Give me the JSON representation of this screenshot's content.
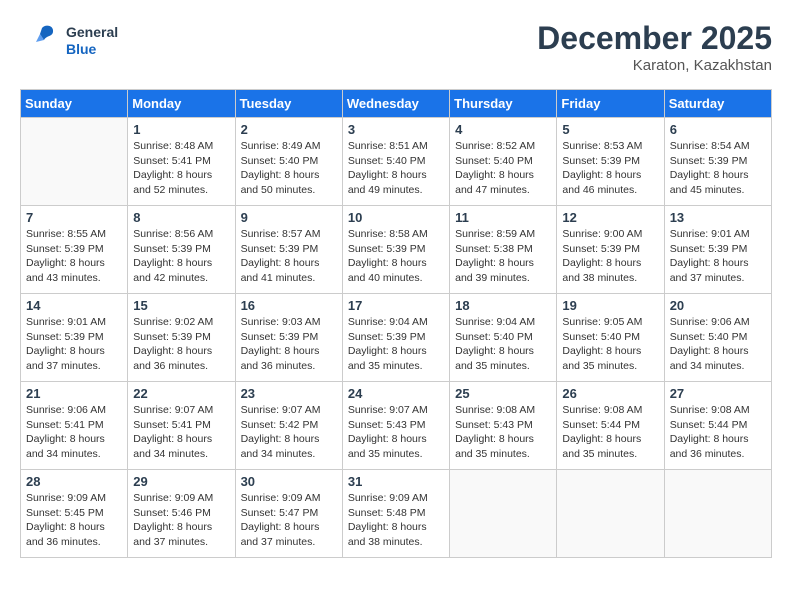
{
  "header": {
    "logo_general": "General",
    "logo_blue": "Blue",
    "month": "December 2025",
    "location": "Karaton, Kazakhstan"
  },
  "weekdays": [
    "Sunday",
    "Monday",
    "Tuesday",
    "Wednesday",
    "Thursday",
    "Friday",
    "Saturday"
  ],
  "weeks": [
    [
      {
        "day": "",
        "sunrise": "",
        "sunset": "",
        "daylight": ""
      },
      {
        "day": "1",
        "sunrise": "Sunrise: 8:48 AM",
        "sunset": "Sunset: 5:41 PM",
        "daylight": "Daylight: 8 hours and 52 minutes."
      },
      {
        "day": "2",
        "sunrise": "Sunrise: 8:49 AM",
        "sunset": "Sunset: 5:40 PM",
        "daylight": "Daylight: 8 hours and 50 minutes."
      },
      {
        "day": "3",
        "sunrise": "Sunrise: 8:51 AM",
        "sunset": "Sunset: 5:40 PM",
        "daylight": "Daylight: 8 hours and 49 minutes."
      },
      {
        "day": "4",
        "sunrise": "Sunrise: 8:52 AM",
        "sunset": "Sunset: 5:40 PM",
        "daylight": "Daylight: 8 hours and 47 minutes."
      },
      {
        "day": "5",
        "sunrise": "Sunrise: 8:53 AM",
        "sunset": "Sunset: 5:39 PM",
        "daylight": "Daylight: 8 hours and 46 minutes."
      },
      {
        "day": "6",
        "sunrise": "Sunrise: 8:54 AM",
        "sunset": "Sunset: 5:39 PM",
        "daylight": "Daylight: 8 hours and 45 minutes."
      }
    ],
    [
      {
        "day": "7",
        "sunrise": "Sunrise: 8:55 AM",
        "sunset": "Sunset: 5:39 PM",
        "daylight": "Daylight: 8 hours and 43 minutes."
      },
      {
        "day": "8",
        "sunrise": "Sunrise: 8:56 AM",
        "sunset": "Sunset: 5:39 PM",
        "daylight": "Daylight: 8 hours and 42 minutes."
      },
      {
        "day": "9",
        "sunrise": "Sunrise: 8:57 AM",
        "sunset": "Sunset: 5:39 PM",
        "daylight": "Daylight: 8 hours and 41 minutes."
      },
      {
        "day": "10",
        "sunrise": "Sunrise: 8:58 AM",
        "sunset": "Sunset: 5:39 PM",
        "daylight": "Daylight: 8 hours and 40 minutes."
      },
      {
        "day": "11",
        "sunrise": "Sunrise: 8:59 AM",
        "sunset": "Sunset: 5:38 PM",
        "daylight": "Daylight: 8 hours and 39 minutes."
      },
      {
        "day": "12",
        "sunrise": "Sunrise: 9:00 AM",
        "sunset": "Sunset: 5:39 PM",
        "daylight": "Daylight: 8 hours and 38 minutes."
      },
      {
        "day": "13",
        "sunrise": "Sunrise: 9:01 AM",
        "sunset": "Sunset: 5:39 PM",
        "daylight": "Daylight: 8 hours and 37 minutes."
      }
    ],
    [
      {
        "day": "14",
        "sunrise": "Sunrise: 9:01 AM",
        "sunset": "Sunset: 5:39 PM",
        "daylight": "Daylight: 8 hours and 37 minutes."
      },
      {
        "day": "15",
        "sunrise": "Sunrise: 9:02 AM",
        "sunset": "Sunset: 5:39 PM",
        "daylight": "Daylight: 8 hours and 36 minutes."
      },
      {
        "day": "16",
        "sunrise": "Sunrise: 9:03 AM",
        "sunset": "Sunset: 5:39 PM",
        "daylight": "Daylight: 8 hours and 36 minutes."
      },
      {
        "day": "17",
        "sunrise": "Sunrise: 9:04 AM",
        "sunset": "Sunset: 5:39 PM",
        "daylight": "Daylight: 8 hours and 35 minutes."
      },
      {
        "day": "18",
        "sunrise": "Sunrise: 9:04 AM",
        "sunset": "Sunset: 5:40 PM",
        "daylight": "Daylight: 8 hours and 35 minutes."
      },
      {
        "day": "19",
        "sunrise": "Sunrise: 9:05 AM",
        "sunset": "Sunset: 5:40 PM",
        "daylight": "Daylight: 8 hours and 35 minutes."
      },
      {
        "day": "20",
        "sunrise": "Sunrise: 9:06 AM",
        "sunset": "Sunset: 5:40 PM",
        "daylight": "Daylight: 8 hours and 34 minutes."
      }
    ],
    [
      {
        "day": "21",
        "sunrise": "Sunrise: 9:06 AM",
        "sunset": "Sunset: 5:41 PM",
        "daylight": "Daylight: 8 hours and 34 minutes."
      },
      {
        "day": "22",
        "sunrise": "Sunrise: 9:07 AM",
        "sunset": "Sunset: 5:41 PM",
        "daylight": "Daylight: 8 hours and 34 minutes."
      },
      {
        "day": "23",
        "sunrise": "Sunrise: 9:07 AM",
        "sunset": "Sunset: 5:42 PM",
        "daylight": "Daylight: 8 hours and 34 minutes."
      },
      {
        "day": "24",
        "sunrise": "Sunrise: 9:07 AM",
        "sunset": "Sunset: 5:43 PM",
        "daylight": "Daylight: 8 hours and 35 minutes."
      },
      {
        "day": "25",
        "sunrise": "Sunrise: 9:08 AM",
        "sunset": "Sunset: 5:43 PM",
        "daylight": "Daylight: 8 hours and 35 minutes."
      },
      {
        "day": "26",
        "sunrise": "Sunrise: 9:08 AM",
        "sunset": "Sunset: 5:44 PM",
        "daylight": "Daylight: 8 hours and 35 minutes."
      },
      {
        "day": "27",
        "sunrise": "Sunrise: 9:08 AM",
        "sunset": "Sunset: 5:44 PM",
        "daylight": "Daylight: 8 hours and 36 minutes."
      }
    ],
    [
      {
        "day": "28",
        "sunrise": "Sunrise: 9:09 AM",
        "sunset": "Sunset: 5:45 PM",
        "daylight": "Daylight: 8 hours and 36 minutes."
      },
      {
        "day": "29",
        "sunrise": "Sunrise: 9:09 AM",
        "sunset": "Sunset: 5:46 PM",
        "daylight": "Daylight: 8 hours and 37 minutes."
      },
      {
        "day": "30",
        "sunrise": "Sunrise: 9:09 AM",
        "sunset": "Sunset: 5:47 PM",
        "daylight": "Daylight: 8 hours and 37 minutes."
      },
      {
        "day": "31",
        "sunrise": "Sunrise: 9:09 AM",
        "sunset": "Sunset: 5:48 PM",
        "daylight": "Daylight: 8 hours and 38 minutes."
      },
      {
        "day": "",
        "sunrise": "",
        "sunset": "",
        "daylight": ""
      },
      {
        "day": "",
        "sunrise": "",
        "sunset": "",
        "daylight": ""
      },
      {
        "day": "",
        "sunrise": "",
        "sunset": "",
        "daylight": ""
      }
    ]
  ]
}
